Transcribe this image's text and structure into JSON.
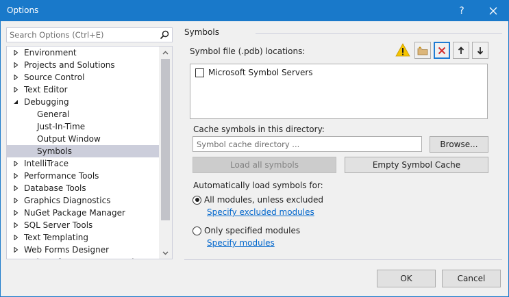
{
  "window": {
    "title": "Options",
    "help_glyph": "?",
    "close_icon": "close-icon"
  },
  "search": {
    "placeholder": "Search Options (Ctrl+E)",
    "icon": "search-icon"
  },
  "tree": {
    "items": [
      {
        "label": "Environment",
        "expanded": false,
        "child": false,
        "selected": false
      },
      {
        "label": "Projects and Solutions",
        "expanded": false,
        "child": false,
        "selected": false
      },
      {
        "label": "Source Control",
        "expanded": false,
        "child": false,
        "selected": false
      },
      {
        "label": "Text Editor",
        "expanded": false,
        "child": false,
        "selected": false
      },
      {
        "label": "Debugging",
        "expanded": true,
        "child": false,
        "selected": false
      },
      {
        "label": "General",
        "expanded": false,
        "child": true,
        "selected": false
      },
      {
        "label": "Just-In-Time",
        "expanded": false,
        "child": true,
        "selected": false
      },
      {
        "label": "Output Window",
        "expanded": false,
        "child": true,
        "selected": false
      },
      {
        "label": "Symbols",
        "expanded": false,
        "child": true,
        "selected": true
      },
      {
        "label": "IntelliTrace",
        "expanded": false,
        "child": false,
        "selected": false
      },
      {
        "label": "Performance Tools",
        "expanded": false,
        "child": false,
        "selected": false
      },
      {
        "label": "Database Tools",
        "expanded": false,
        "child": false,
        "selected": false
      },
      {
        "label": "Graphics Diagnostics",
        "expanded": false,
        "child": false,
        "selected": false
      },
      {
        "label": "NuGet Package Manager",
        "expanded": false,
        "child": false,
        "selected": false
      },
      {
        "label": "SQL Server Tools",
        "expanded": false,
        "child": false,
        "selected": false
      },
      {
        "label": "Text Templating",
        "expanded": false,
        "child": false,
        "selected": false
      },
      {
        "label": "Web Forms Designer",
        "expanded": false,
        "child": false,
        "selected": false
      },
      {
        "label": "Web Performance Test Tools",
        "expanded": false,
        "child": false,
        "selected": false
      }
    ]
  },
  "symbols": {
    "section_title": "Symbols",
    "pdb_label": "Symbol file (.pdb) locations:",
    "locations": [
      {
        "label": "Microsoft Symbol Servers",
        "checked": false
      }
    ],
    "toolbar_icons": [
      "warning-icon",
      "new-folder-icon",
      "remove-icon",
      "move-up-icon",
      "move-down-icon"
    ],
    "cache_label": "Cache symbols in this directory:",
    "cache_placeholder": "Symbol cache directory ...",
    "browse_label": "Browse...",
    "load_all_label": "Load all symbols",
    "empty_cache_label": "Empty Symbol Cache",
    "auto_label": "Automatically load symbols for:",
    "option_all_label": "All modules, unless excluded",
    "link_excluded": "Specify excluded modules",
    "option_specified_label": "Only specified modules",
    "link_specify": "Specify modules",
    "selected_option": "all"
  },
  "footer": {
    "ok_label": "OK",
    "cancel_label": "Cancel"
  },
  "colors": {
    "titlebar": "#1979ca",
    "link": "#0066cc",
    "selection": "#cccedb",
    "warning": "#f5c400",
    "remove": "#d32f2f"
  }
}
